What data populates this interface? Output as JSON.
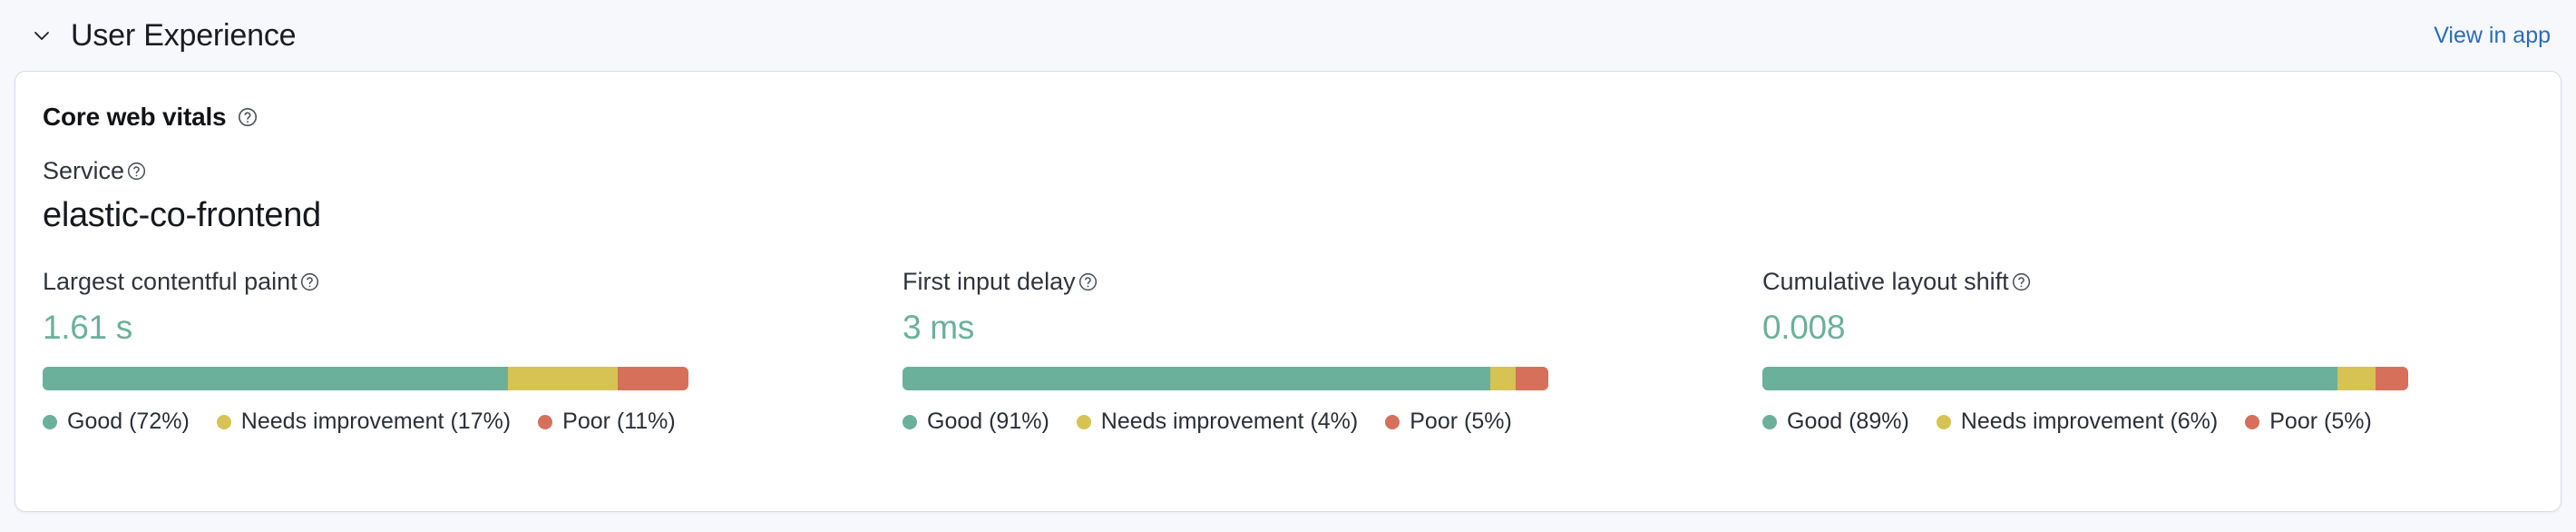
{
  "header": {
    "title": "User Experience",
    "chevron_icon": "chevron-down-icon",
    "view_in_app_label": "View in app",
    "link_color": "#2a6bbd"
  },
  "panel": {
    "title": "Core web vitals",
    "title_help_icon": "help-circle-icon",
    "service": {
      "label": "Service",
      "help_icon": "help-circle-icon",
      "value": "elastic-co-frontend"
    }
  },
  "colors": {
    "good": "#6bb09b",
    "needs_improvement": "#d6c353",
    "poor": "#d6705a",
    "value_text": "#6bb09b",
    "panel_border": "#d6dce8",
    "page_background": "#f7f8fc"
  },
  "legend_labels": {
    "good": "Good",
    "needs_improvement": "Needs improvement",
    "poor": "Poor"
  },
  "metrics": [
    {
      "label": "Largest contentful paint",
      "help_icon": "help-circle-icon",
      "value": "1.61 s",
      "good_pct": 72,
      "needs_pct": 17,
      "poor_pct": 11,
      "legend": {
        "good": "Good (72%)",
        "needs_improvement": "Needs improvement (17%)",
        "poor": "Poor (11%)"
      }
    },
    {
      "label": "First input delay",
      "help_icon": "help-circle-icon",
      "value": "3 ms",
      "good_pct": 91,
      "needs_pct": 4,
      "poor_pct": 5,
      "legend": {
        "good": "Good (91%)",
        "needs_improvement": "Needs improvement (4%)",
        "poor": "Poor (5%)"
      }
    },
    {
      "label": "Cumulative layout shift",
      "help_icon": "help-circle-icon",
      "value": "0.008",
      "good_pct": 89,
      "needs_pct": 6,
      "poor_pct": 5,
      "legend": {
        "good": "Good (89%)",
        "needs_improvement": "Needs improvement (6%)",
        "poor": "Poor (5%)"
      }
    }
  ],
  "chart_data": {
    "type": "bar",
    "title": "Core web vitals",
    "subtitle": "elastic-co-frontend",
    "categories": [
      "Good",
      "Needs improvement",
      "Poor"
    ],
    "series": [
      {
        "name": "Largest contentful paint",
        "values": [
          72,
          17,
          11
        ],
        "summary_value": "1.61 s"
      },
      {
        "name": "First input delay",
        "values": [
          91,
          4,
          5
        ],
        "summary_value": "3 ms"
      },
      {
        "name": "Cumulative layout shift",
        "values": [
          89,
          6,
          5
        ],
        "summary_value": "0.008"
      }
    ],
    "unit": "%",
    "stacked": true,
    "orientation": "horizontal",
    "xlabel": "",
    "ylabel": "",
    "xlim": [
      0,
      100
    ],
    "grid": false,
    "legend_position": "bottom",
    "colors": [
      "#6bb09b",
      "#d6c353",
      "#d6705a"
    ]
  }
}
